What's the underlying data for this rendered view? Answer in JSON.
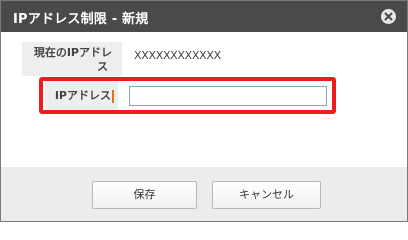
{
  "dialog": {
    "title": "IPアドレス制限 - 新規",
    "close_icon": "close-icon"
  },
  "form": {
    "current_ip_label_line1": "現在のIPアドレ",
    "current_ip_label_line2": "ス",
    "current_ip_value": "XXXXXXXXXXXX",
    "ip_label": "IPアドレス",
    "ip_input_value": "",
    "ip_input_placeholder": ""
  },
  "buttons": {
    "save_label": "保存",
    "cancel_label": "キャンセル"
  },
  "colors": {
    "titlebar_bg": "#4a4a4a",
    "highlight": "#ee1c1c",
    "required_mark": "#e8701a",
    "footer_bg": "#ececec",
    "input_border": "#8aa3bf"
  }
}
